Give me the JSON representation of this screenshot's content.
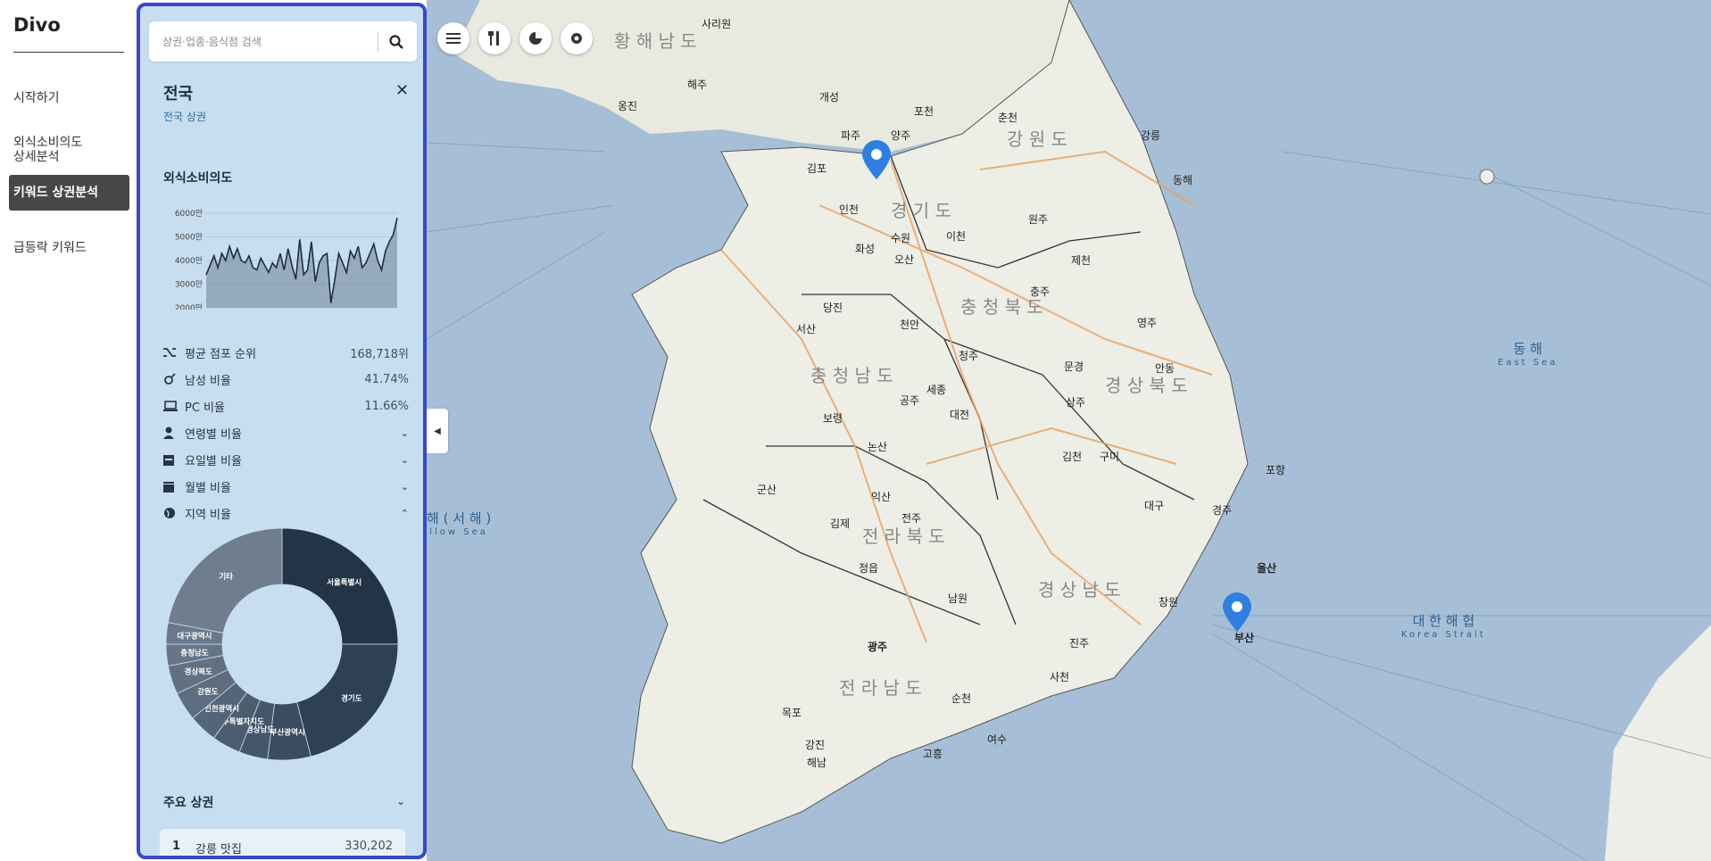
{
  "nav": {
    "brand": "Divo",
    "items": [
      {
        "label": "시작하기"
      },
      {
        "label": "외식소비의도\n상세분석"
      },
      {
        "label": "키워드 상권분석"
      },
      {
        "label": "급등락 키워드"
      }
    ]
  },
  "search": {
    "placeholder": "상권·업종·음식점 검색"
  },
  "panel": {
    "region_title": "전국",
    "region_sub": "전국 상권",
    "spend_title": "외식소비의도",
    "stats": [
      {
        "icon": "shuffle-icon",
        "label": "평균 점포 순위",
        "value": "168,718위"
      },
      {
        "icon": "gender-icon",
        "label": "남성 비율",
        "value": "41.74%"
      },
      {
        "icon": "laptop-icon",
        "label": "PC 비율",
        "value": "11.66%"
      },
      {
        "icon": "person-icon",
        "label": "연령별 비율",
        "value": ""
      },
      {
        "icon": "calendar-week-icon",
        "label": "요일별 비율",
        "value": ""
      },
      {
        "icon": "calendar-month-icon",
        "label": "월별 비율",
        "value": ""
      },
      {
        "icon": "globe-icon",
        "label": "지역 비율",
        "value": ""
      }
    ],
    "main_title": "주요 상권",
    "top_row": {
      "rank": "1",
      "name": "강릉 맛집",
      "value": "330,202"
    }
  },
  "chart_data": [
    {
      "type": "line",
      "title": "",
      "ylabel": "",
      "yticks": [
        "6000만",
        "5000만",
        "4000만",
        "3000만",
        "2000만"
      ],
      "ylim": [
        2000,
        6000
      ],
      "values": [
        3400,
        3800,
        4200,
        3700,
        4300,
        4000,
        4600,
        4100,
        4500,
        4000,
        3900,
        4200,
        3700,
        3600,
        4100,
        3800,
        3500,
        3900,
        3700,
        4300,
        3600,
        4500,
        3800,
        3200,
        4900,
        3400,
        3600,
        4800,
        3100,
        3900,
        4200,
        4300,
        2200,
        3200,
        4300,
        3900,
        3500,
        4400,
        4100,
        4600,
        3700,
        3900,
        4300,
        4700,
        4000,
        3600,
        4400,
        4800,
        5100,
        5800
      ],
      "grid": true,
      "color": "#1d2d44"
    },
    {
      "type": "pie",
      "title": "",
      "donut": true,
      "slices": [
        {
          "label": "서울특별시",
          "value": 25,
          "color": "#243447"
        },
        {
          "label": "경기도",
          "value": 21,
          "color": "#2e4055"
        },
        {
          "label": "부산광역시",
          "value": 6,
          "color": "#3c4c60"
        },
        {
          "label": "경상남도",
          "value": 4,
          "color": "#45566a"
        },
        {
          "label": "제주특별자치도",
          "value": 4,
          "color": "#4d5d70"
        },
        {
          "label": "인천광역시",
          "value": 4,
          "color": "#556578"
        },
        {
          "label": "강원도",
          "value": 4,
          "color": "#5d6c7e"
        },
        {
          "label": "경상북도",
          "value": 4,
          "color": "#627182"
        },
        {
          "label": "충청남도",
          "value": 3,
          "color": "#667586"
        },
        {
          "label": "대구광역시",
          "value": 3,
          "color": "#6a798a"
        },
        {
          "label": "기타",
          "value": 22,
          "color": "#6f7d8e"
        }
      ]
    }
  ],
  "map": {
    "sea_east": {
      "ko": "동 해",
      "en": "East Sea"
    },
    "sea_west": {
      "ko": "해 ( 서 해 )",
      "en": "llow Sea"
    },
    "strait": {
      "ko": "대 한 해 협",
      "en": "Korea Strait"
    },
    "places": [
      "황 해 남 도",
      "강 원 도",
      "경 기 도",
      "충 청 북 도",
      "충 청 남 도",
      "경 상 북 도",
      "전 라 북 도",
      "경 상 남 도",
      "전 라 남 도",
      "강릉",
      "동해",
      "춘천",
      "개성",
      "파주",
      "양주",
      "포천",
      "원주",
      "충주",
      "제천",
      "청주",
      "천안",
      "서산",
      "당진",
      "공주",
      "세종",
      "대전",
      "상주",
      "문경",
      "영주",
      "안동",
      "구미",
      "김천",
      "대구",
      "경주",
      "포항",
      "울산",
      "부산",
      "창원",
      "진주",
      "사천",
      "전주",
      "군산",
      "익산",
      "김제",
      "정읍",
      "남원",
      "광주",
      "목포",
      "순천",
      "여수",
      "고흥",
      "해남",
      "강진",
      "보령",
      "논산",
      "수원",
      "이천",
      "화성",
      "오산",
      "인천",
      "김포",
      "해주",
      "옹진",
      "사리원"
    ]
  }
}
